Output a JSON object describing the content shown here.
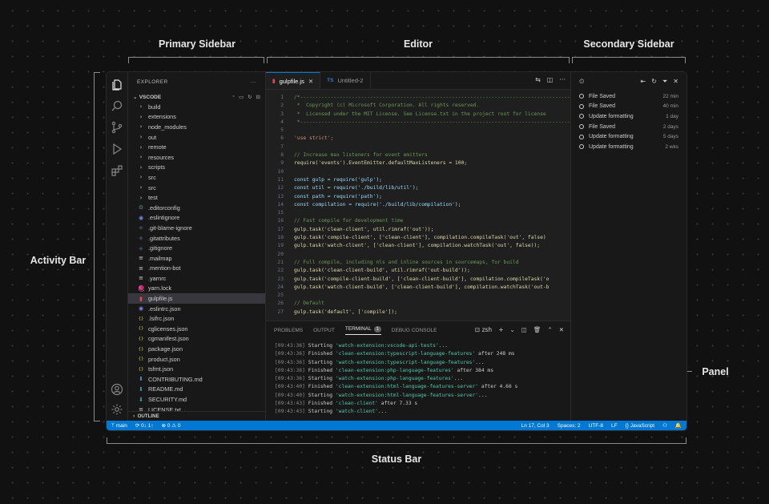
{
  "callouts": {
    "primary_sidebar": "Primary Sidebar",
    "editor": "Editor",
    "secondary_sidebar": "Secondary Sidebar",
    "activity_bar": "Activity Bar",
    "panel": "Panel",
    "status_bar": "Status Bar"
  },
  "activity_bar": {
    "icons": [
      "explorer-icon",
      "search-icon",
      "source-control-icon",
      "run-debug-icon",
      "extensions-icon",
      "account-icon",
      "manage-gear-icon"
    ]
  },
  "sidebar": {
    "title": "EXPLORER",
    "more": "···",
    "folder": "VSCODE",
    "outline": "OUTLINE",
    "items": [
      {
        "label": "build",
        "kind": "folder"
      },
      {
        "label": "extensions",
        "kind": "folder"
      },
      {
        "label": "node_modules",
        "kind": "folder"
      },
      {
        "label": "out",
        "kind": "folder"
      },
      {
        "label": "remote",
        "kind": "folder"
      },
      {
        "label": "resources",
        "kind": "folder"
      },
      {
        "label": "scripts",
        "kind": "folder"
      },
      {
        "label": "src",
        "kind": "folder"
      },
      {
        "label": "src",
        "kind": "folder"
      },
      {
        "label": "test",
        "kind": "folder"
      },
      {
        "label": ".editorconfig",
        "kind": "gear"
      },
      {
        "label": ".eslintignore",
        "kind": "eslint"
      },
      {
        "label": ".git-blame-ignore",
        "kind": "git"
      },
      {
        "label": ".gitattributes",
        "kind": "git"
      },
      {
        "label": ".gitignore",
        "kind": "git"
      },
      {
        "label": ".mailmap",
        "kind": "text"
      },
      {
        "label": ".mention-bot",
        "kind": "text"
      },
      {
        "label": ".yarnrc",
        "kind": "text"
      },
      {
        "label": "yarn.lock",
        "kind": "yarn"
      },
      {
        "label": "gulpfile.js",
        "kind": "gulp",
        "selected": true
      },
      {
        "label": ".eslintrc.json",
        "kind": "eslint"
      },
      {
        "label": ".lsifrc.json",
        "kind": "json"
      },
      {
        "label": "cglicenses.json",
        "kind": "json"
      },
      {
        "label": "cgmanifest.json",
        "kind": "json"
      },
      {
        "label": "package.json",
        "kind": "json"
      },
      {
        "label": "product.json",
        "kind": "json"
      },
      {
        "label": "tsfmt.json",
        "kind": "json"
      },
      {
        "label": "CONTRIBUTING.md",
        "kind": "md"
      },
      {
        "label": "README.md",
        "kind": "md"
      },
      {
        "label": "SECURITY.md",
        "kind": "md"
      },
      {
        "label": "LICENSE.txt",
        "kind": "text"
      }
    ]
  },
  "editor": {
    "tabs": [
      {
        "label": "gulpfile.js",
        "icon": "gulp",
        "active": true
      },
      {
        "label": "Untitled-2",
        "icon": "TS",
        "active": false
      }
    ],
    "lines": [
      {
        "n": "1",
        "text": "/*---------------------------------------------------------------------------------------------",
        "color": "#6a9955"
      },
      {
        "n": "2",
        "text": " *  Copyright (c) Microsoft Corporation. All rights reserved.",
        "color": "#6a9955"
      },
      {
        "n": "3",
        "text": " *  Licensed under the MIT License. See License.txt in the project root for license",
        "color": "#6a9955"
      },
      {
        "n": "4",
        "text": " *--------------------------------------------------------------------------------------------*/",
        "color": "#6a9955"
      },
      {
        "n": "5",
        "text": "",
        "color": "#cccccc"
      },
      {
        "n": "6",
        "text": "'use strict';",
        "color": "#ce9178"
      },
      {
        "n": "7",
        "text": "",
        "color": "#cccccc"
      },
      {
        "n": "8",
        "text": "// Increase max listeners for event emitters",
        "color": "#6a9955"
      },
      {
        "n": "9",
        "text": "require('events').EventEmitter.defaultMaxListeners = 100;",
        "color": "#dcdcaa"
      },
      {
        "n": "10",
        "text": "",
        "color": "#cccccc"
      },
      {
        "n": "11",
        "text": "const gulp = require('gulp');",
        "color": "#9cdcfe"
      },
      {
        "n": "12",
        "text": "const util = require('./build/lib/util');",
        "color": "#9cdcfe"
      },
      {
        "n": "13",
        "text": "const path = require('path');",
        "color": "#9cdcfe"
      },
      {
        "n": "14",
        "text": "const compilation = require('./build/lib/compilation');",
        "color": "#9cdcfe"
      },
      {
        "n": "15",
        "text": "",
        "color": "#cccccc"
      },
      {
        "n": "16",
        "text": "// Fast compile for development time",
        "color": "#6a9955"
      },
      {
        "n": "17",
        "text": "gulp.task('clean-client', util.rimraf('out'));",
        "color": "#dcdcaa"
      },
      {
        "n": "18",
        "text": "gulp.task('compile-client', ['clean-client'], compilation.compileTask('out', false)",
        "color": "#dcdcaa"
      },
      {
        "n": "19",
        "text": "gulp.task('watch-client', ['clean-client'], compilation.watchTask('out', false));",
        "color": "#dcdcaa"
      },
      {
        "n": "20",
        "text": "",
        "color": "#cccccc"
      },
      {
        "n": "21",
        "text": "// Full compile, including nls and inline sources in sourcemaps, for build",
        "color": "#6a9955"
      },
      {
        "n": "22",
        "text": "gulp.task('clean-client-build', util.rimraf('out-build'));",
        "color": "#dcdcaa"
      },
      {
        "n": "23",
        "text": "gulp.task('compile-client-build', ['clean-client-build'], compilation.compileTask('o",
        "color": "#dcdcaa"
      },
      {
        "n": "24",
        "text": "gulp.task('watch-client-build', ['clean-client-build'], compilation.watchTask('out-b",
        "color": "#dcdcaa"
      },
      {
        "n": "25",
        "text": "",
        "color": "#cccccc"
      },
      {
        "n": "26",
        "text": "// Default",
        "color": "#6a9955"
      },
      {
        "n": "27",
        "text": "gulp.task('default', ['compile']);",
        "color": "#dcdcaa"
      }
    ]
  },
  "panel": {
    "tabs": [
      "PROBLEMS",
      "OUTPUT",
      "TERMINAL",
      "DEBUG CONSOLE"
    ],
    "active_tab": "TERMINAL",
    "terminal_badge": "1",
    "shell": "zsh",
    "lines": [
      {
        "ts": "[09:43:36]",
        "verb": "Starting",
        "task": "'watch-extension:vscode-api-tests'",
        "tail": "..."
      },
      {
        "ts": "[09:43:36]",
        "verb": "Finished",
        "task": "'clean-extension:typescript-language-features'",
        "tail": " after 248 ms"
      },
      {
        "ts": "[09:43:36]",
        "verb": "Starting",
        "task": "'watch-extension:typescript-language-features'",
        "tail": "..."
      },
      {
        "ts": "[09:43:36]",
        "verb": "Finished",
        "task": "'clean-extension:php-language-features'",
        "tail": " after 384 ms"
      },
      {
        "ts": "[09:43:36]",
        "verb": "Starting",
        "task": "'watch-extension:php-language-features'",
        "tail": "..."
      },
      {
        "ts": "[09:43:40]",
        "verb": "Finished",
        "task": "'clean-extension:html-language-features-server'",
        "tail": " after 4.66 s"
      },
      {
        "ts": "[09:43:40]",
        "verb": "Starting",
        "task": "'watch-extension:html-language-features-server'",
        "tail": "..."
      },
      {
        "ts": "[09:43:43]",
        "verb": "Finished",
        "task": "'clean-client'",
        "tail": " after 7.33 s"
      },
      {
        "ts": "[09:43:43]",
        "verb": "Starting",
        "task": "'watch-client'",
        "tail": "..."
      }
    ]
  },
  "secondary": {
    "timeline": [
      {
        "label": "File Saved",
        "when": "22 min",
        "kind": "save"
      },
      {
        "label": "File Saved",
        "when": "40 min",
        "kind": "save"
      },
      {
        "label": "Update formatting",
        "when": "1 day",
        "kind": "commit"
      },
      {
        "label": "File Saved",
        "when": "2 days",
        "kind": "save"
      },
      {
        "label": "Update formatting",
        "when": "5 days",
        "kind": "commit"
      },
      {
        "label": "Update formatting",
        "when": "2 wks",
        "kind": "commit"
      }
    ]
  },
  "status_bar": {
    "branch": "main",
    "sync": "0↓ 1↑",
    "problems": "⊗ 0 ⚠ 0",
    "position": "Ln 17, Col 3",
    "spaces": "Spaces: 2",
    "encoding": "UTF-8",
    "eol": "LF",
    "language": "{} JavaScript",
    "color": "#0078d4"
  }
}
